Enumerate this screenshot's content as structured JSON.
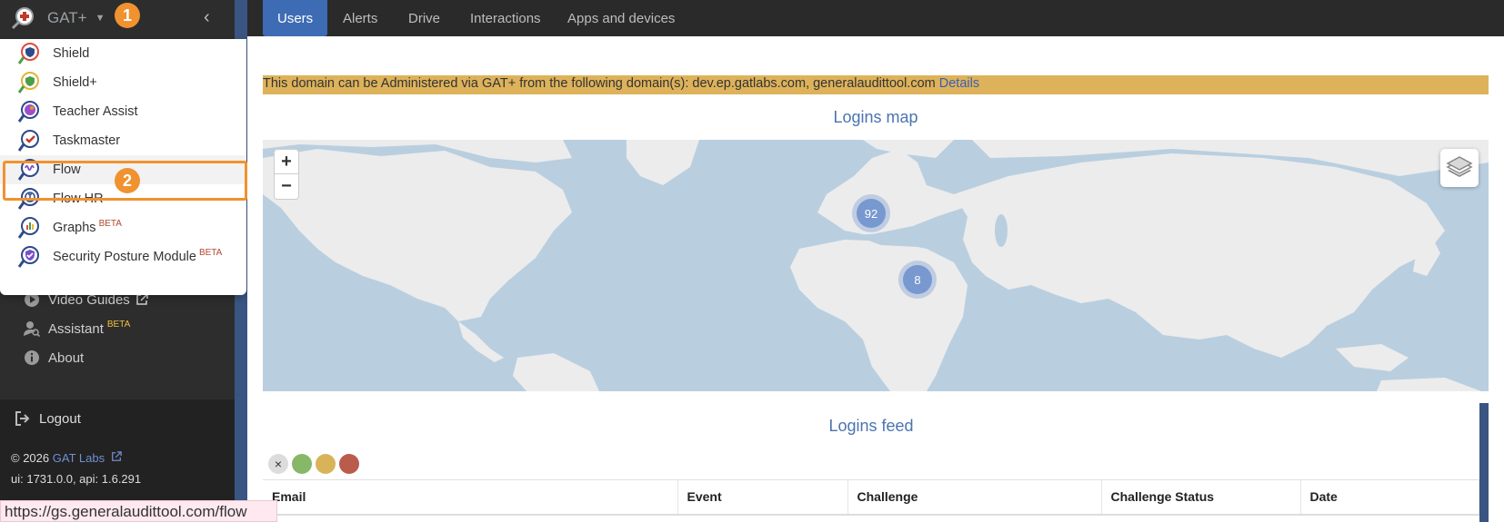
{
  "app": {
    "name": "GAT+",
    "badge_1": "1",
    "badge_2": "2"
  },
  "dropdown": {
    "items": [
      {
        "label": "Shield",
        "beta": ""
      },
      {
        "label": "Shield+",
        "beta": ""
      },
      {
        "label": "Teacher Assist",
        "beta": ""
      },
      {
        "label": "Taskmaster",
        "beta": ""
      },
      {
        "label": "Flow",
        "beta": ""
      },
      {
        "label": "Flow HR",
        "beta": ""
      },
      {
        "label": "Graphs",
        "beta": "BETA"
      },
      {
        "label": "Security Posture Module",
        "beta": "BETA"
      }
    ]
  },
  "sidebar": {
    "links": [
      {
        "label": "Video Guides",
        "beta": ""
      },
      {
        "label": "Assistant",
        "beta": "BETA"
      },
      {
        "label": "About",
        "beta": ""
      }
    ],
    "logout": "Logout",
    "copyright_prefix": "© 2026",
    "copyright_link": "GAT Labs",
    "version": "ui: 1731.0.0, api: 1.6.291"
  },
  "status_url": "https://gs.generalaudittool.com/flow",
  "tabs": [
    "Users",
    "Alerts",
    "Drive",
    "Interactions",
    "Apps and devices"
  ],
  "banner": {
    "text": "This domain can be Administered via GAT+ from the following domain(s): dev.ep.gatlabs.com, generalaudittool.com",
    "link": "Details"
  },
  "map": {
    "title": "Logins map",
    "zoom_in": "+",
    "zoom_out": "−",
    "clusters": [
      "92",
      "8"
    ]
  },
  "feed": {
    "title": "Logins feed",
    "clear": "×",
    "columns": [
      "Email",
      "Event",
      "Challenge",
      "Challenge Status",
      "Date"
    ]
  },
  "colors": {
    "accent": "#3e6cb4",
    "highlight_border": "#f0922f",
    "banner": "#ddb25a",
    "dot_green": "#86b867",
    "dot_yellow": "#d9b35a",
    "dot_red": "#b95c4c"
  }
}
